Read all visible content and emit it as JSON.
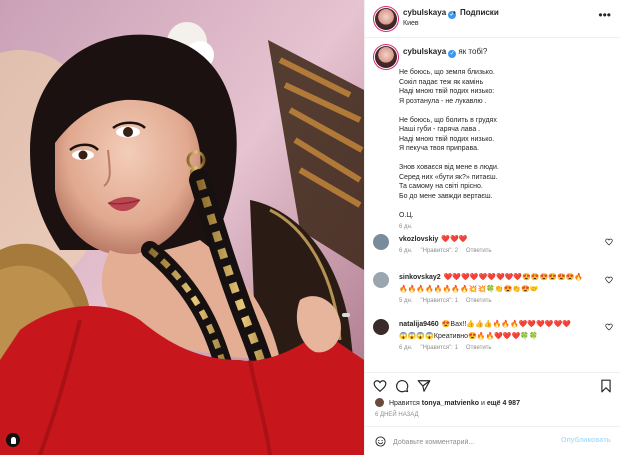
{
  "post": {
    "username": "cybulskaya",
    "follow_label": "Подписки",
    "location": "Киев",
    "separator": "•",
    "more_icon": "more-horizontal-icon"
  },
  "caption": {
    "username": "cybulskaya",
    "title": "як тобі?",
    "stanzas": [
      [
        "Не боюсь, що земля близько.",
        "Сокіл падає теж як камінь",
        "Наді мною твій подих низько:",
        "Я розтанула - не лукавлю ."
      ],
      [
        "Не боюсь, що болить в грудях",
        "Наші губи - гаряча лава .",
        "Наді мною твій подих низько.",
        "Я пекуча твоя приправа."
      ],
      [
        "Знов ховаєся від мене в люди.",
        "Серед них «бути як?» питаєш.",
        "Та самому на світі прісно.",
        "Бо до мене завжди вертаєш."
      ],
      [
        "О.Ц."
      ]
    ],
    "time": "6 дн."
  },
  "comments": [
    {
      "username": "vkozlovskiy",
      "text": "❤️❤️❤️",
      "text2": "",
      "time": "6 дн.",
      "likes": "\"Нравится\": 2",
      "reply": "Ответить",
      "avatar_color": "#7a8b99"
    },
    {
      "username": "sinkovskay2",
      "text": "❤️❤️❤️❤️❤️❤️❤️❤️❤️😍😍😍😍😍😍🔥",
      "text2": "🔥🔥🔥🔥🔥🔥🔥🔥💥💥🍀👏😍👏😍🤝",
      "time": "5 дн.",
      "likes": "\"Нравится\": 1",
      "reply": "Ответить",
      "avatar_color": "#9aa5ad"
    },
    {
      "username": "natalija9460",
      "text": "😍Вах!!👍👍👍🔥🔥🔥❤️❤️❤️❤️❤️❤️",
      "text2": "😱😱😱😱Креативно😍🔥🔥❤️❤️❤️🍀🍀",
      "time": "6 дн.",
      "likes": "\"Нравится\": 1",
      "reply": "Ответить",
      "avatar_color": "#3a2a2a"
    }
  ],
  "actions": {
    "like_icon": "heart-icon",
    "comment_icon": "comment-icon",
    "share_icon": "send-icon",
    "save_icon": "bookmark-icon"
  },
  "likes": {
    "prefix": "Нравится",
    "user": "tonya_matvienko",
    "mid": "и",
    "more": "ещё 4 987"
  },
  "post_time": "6 ДНЕЙ НАЗАД",
  "add_comment": {
    "placeholder": "Добавьте комментарий...",
    "publish_label": "Опубликовать",
    "publish_color": "#b2dffc"
  },
  "colors": {
    "verified": "#3897f0",
    "dress": "#c8161d",
    "muted": "#8e8e8e"
  }
}
